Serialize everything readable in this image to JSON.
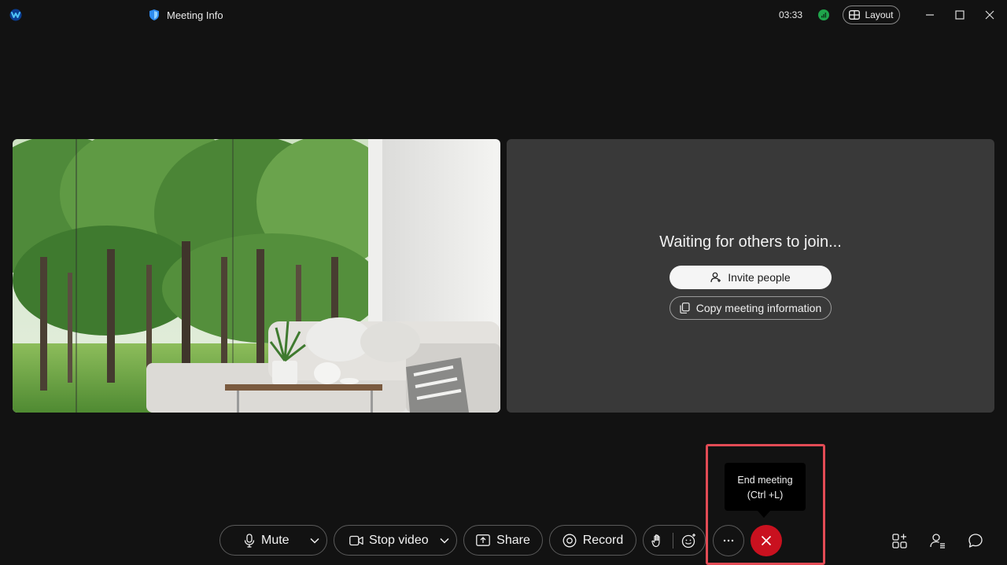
{
  "titlebar": {
    "meeting_info": "Meeting Info",
    "timer": "03:33",
    "layout_label": "Layout"
  },
  "waiting": {
    "message": "Waiting for others to join...",
    "invite_label": "Invite people",
    "copy_label": "Copy meeting information"
  },
  "tooltip": {
    "line1": "End meeting",
    "line2": "(Ctrl +L)"
  },
  "controls": {
    "mute_label": "Mute",
    "stop_video_label": "Stop video",
    "share_label": "Share",
    "record_label": "Record"
  },
  "colors": {
    "end_button": "#c9111f",
    "highlight": "#e24b55",
    "signal": "#1fa54b"
  }
}
